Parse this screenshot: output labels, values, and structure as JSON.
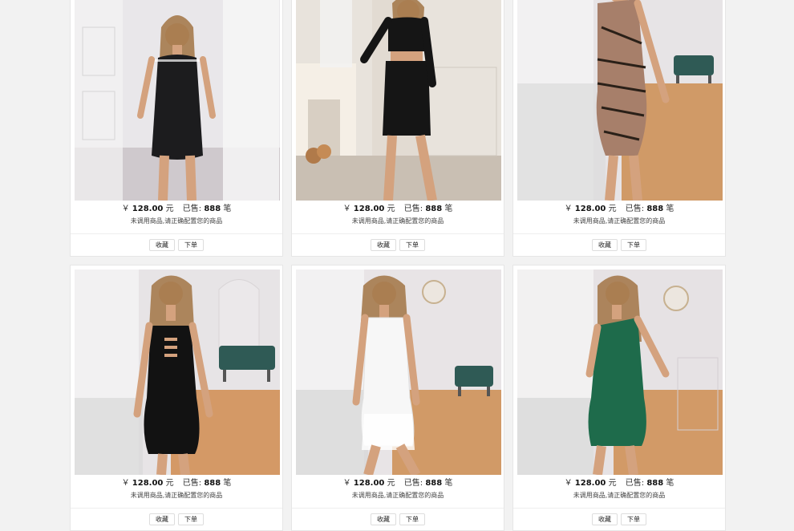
{
  "products": [
    {
      "currency": "￥",
      "price": "128.00",
      "unit": "元",
      "sold_label": "已售:",
      "sold": "888",
      "sold_unit": "笔",
      "note": "未调用商品,请正确配置您的商品",
      "fav": "收藏",
      "order": "下单",
      "dress_color": "#1c1c1e",
      "bg": "#e9e7ea",
      "floor": "#cfc9cd",
      "accent": "#ffffff"
    },
    {
      "currency": "￥",
      "price": "128.00",
      "unit": "元",
      "sold_label": "已售:",
      "sold": "888",
      "sold_unit": "笔",
      "note": "未调用商品,请正确配置您的商品",
      "fav": "收藏",
      "order": "下单",
      "dress_color": "#151515",
      "bg": "#e8e3dc",
      "floor": "#c9bfb3",
      "accent": "#f5efe6"
    },
    {
      "currency": "￥",
      "price": "128.00",
      "unit": "元",
      "sold_label": "已售:",
      "sold": "888",
      "sold_unit": "笔",
      "note": "未调用商品,请正确配置您的商品",
      "fav": "收藏",
      "order": "下单",
      "dress_color": "#a77f6a",
      "bg": "#e7e4e6",
      "floor": "#d09a67",
      "accent": "#2f5a55"
    },
    {
      "currency": "￥",
      "price": "128.00",
      "unit": "元",
      "sold_label": "已售:",
      "sold": "888",
      "sold_unit": "笔",
      "note": "未调用商品,请正确配置您的商品",
      "fav": "收藏",
      "order": "下单",
      "dress_color": "#121212",
      "bg": "#e7e4e6",
      "floor": "#d49966",
      "accent": "#2f5a55"
    },
    {
      "currency": "￥",
      "price": "128.00",
      "unit": "元",
      "sold_label": "已售:",
      "sold": "888",
      "sold_unit": "笔",
      "note": "未调用商品,请正确配置您的商品",
      "fav": "收藏",
      "order": "下单",
      "dress_color": "#f7f7f7",
      "bg": "#e8e4e6",
      "floor": "#d19a67",
      "accent": "#2f5a55"
    },
    {
      "currency": "￥",
      "price": "128.00",
      "unit": "元",
      "sold_label": "已售:",
      "sold": "888",
      "sold_unit": "笔",
      "note": "未调用商品,请正确配置您的商品",
      "fav": "收藏",
      "order": "下单",
      "dress_color": "#1e6b4b",
      "bg": "#e6e2e4",
      "floor": "#d29a67",
      "accent": "#ffffff"
    }
  ]
}
